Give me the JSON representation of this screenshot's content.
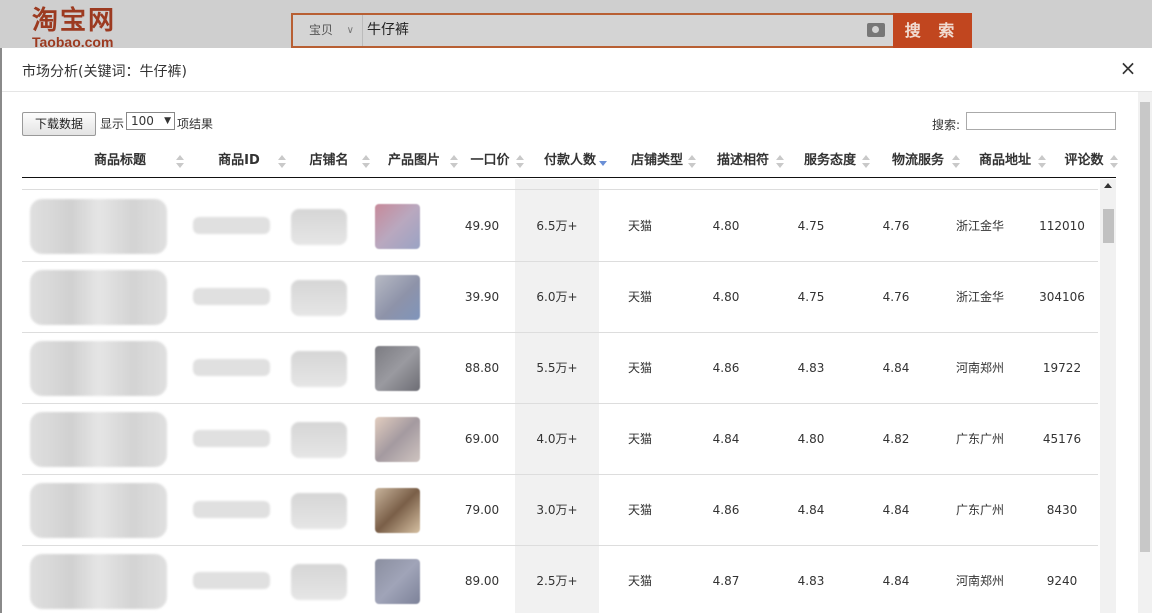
{
  "header": {
    "logo_cn": "淘宝网",
    "logo_en": "Taobao.com",
    "search_type": "宝贝",
    "search_query": "牛仔裤",
    "search_button": "搜 索"
  },
  "modal": {
    "title": "市场分析(关键词：牛仔裤)",
    "close_label": "×",
    "download_button": "下载数据",
    "show_label": "显示",
    "page_length": "100",
    "results_label": "项结果",
    "search_label": "搜索:",
    "search_value": ""
  },
  "table": {
    "columns": [
      "商品标题",
      "商品ID",
      "店铺名",
      "产品图片",
      "一口价",
      "付款人数",
      "店铺类型",
      "描述相符",
      "服务态度",
      "物流服务",
      "商品地址",
      "评论数"
    ],
    "sorted_column": "付款人数",
    "rows": [
      {
        "price": "49.90",
        "paid": "6.5万+",
        "shop_type": "天猫",
        "desc": "4.80",
        "service": "4.75",
        "logistics": "4.76",
        "location": "浙江金华",
        "reviews": "112010"
      },
      {
        "price": "39.90",
        "paid": "6.0万+",
        "shop_type": "天猫",
        "desc": "4.80",
        "service": "4.75",
        "logistics": "4.76",
        "location": "浙江金华",
        "reviews": "304106"
      },
      {
        "price": "88.80",
        "paid": "5.5万+",
        "shop_type": "天猫",
        "desc": "4.86",
        "service": "4.83",
        "logistics": "4.84",
        "location": "河南郑州",
        "reviews": "19722"
      },
      {
        "price": "69.00",
        "paid": "4.0万+",
        "shop_type": "天猫",
        "desc": "4.84",
        "service": "4.80",
        "logistics": "4.82",
        "location": "广东广州",
        "reviews": "45176"
      },
      {
        "price": "79.00",
        "paid": "3.0万+",
        "shop_type": "天猫",
        "desc": "4.86",
        "service": "4.84",
        "logistics": "4.84",
        "location": "广东广州",
        "reviews": "8430"
      },
      {
        "price": "89.00",
        "paid": "2.5万+",
        "shop_type": "天猫",
        "desc": "4.87",
        "service": "4.83",
        "logistics": "4.84",
        "location": "河南郑州",
        "reviews": "9240"
      }
    ]
  },
  "colors": {
    "brand": "#c1461f",
    "sort_active": "#6a8fd6"
  }
}
